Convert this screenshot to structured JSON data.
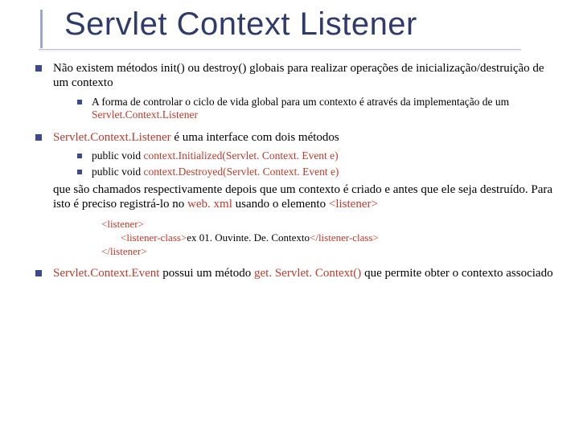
{
  "title": "Servlet Context Listener",
  "b1": {
    "text": "Não existem métodos init() ou destroy() globais para realizar operações de inicialização/destruição de um contexto",
    "sub1_a": "A forma de controlar o ciclo de vida global para um contexto é através da implementação de um ",
    "sub1_b": "Servlet.Context.Listener"
  },
  "b2": {
    "lead": "Servlet.Context.Listener",
    "rest": " é uma interface com dois métodos",
    "m1_a": "public void ",
    "m1_b": "context.Initialized(Servlet. Context. Event e)",
    "m2_a": "public void ",
    "m2_b": "context.Destroyed(Servlet. Context. Event e)",
    "cont_a": "que são chamados respectivamente depois que um contexto é criado e antes que ele seja destruído. Para isto é preciso registrá-lo no ",
    "cont_b": "web. xml",
    "cont_c": " usando o elemento ",
    "cont_d": "<listener>"
  },
  "code": {
    "l1": "<listener>",
    "l2a": "<listener-class>",
    "l2b": "ex 01. Ouvinte. De. Contexto",
    "l2c": "</listener-class>",
    "l3": "</listener>"
  },
  "b3": {
    "a": "Servlet.Context.Event",
    "b": " possui um método  ",
    "c": "get. Servlet. Context()",
    "d": " que permite obter o contexto associado"
  }
}
